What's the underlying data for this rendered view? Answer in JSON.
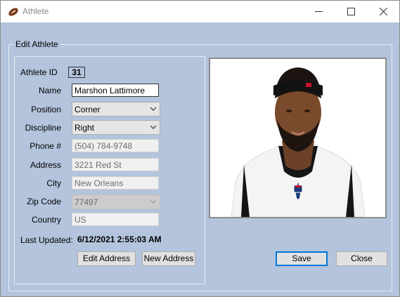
{
  "window": {
    "title": "Athlete",
    "icon": "football-icon"
  },
  "form": {
    "group_title": "Edit Athlete",
    "athlete_id_label": "Athlete ID",
    "athlete_id": "31",
    "name_label": "Name",
    "name_value": "Marshon Lattimore",
    "position_label": "Position",
    "position_value": "Corner",
    "discipline_label": "Discipline",
    "discipline_value": "Right",
    "phone_label": "Phone #",
    "phone_value": "(504) 784-9748",
    "address_label": "Address",
    "address_value": "3221 Red St",
    "city_label": "City",
    "city_value": "New Orleans",
    "zip_label": "Zip Code",
    "zip_value": "77497",
    "country_label": "Country",
    "country_value": "US",
    "last_updated_label": "Last Updated:",
    "last_updated_value": "6/12/2021 2:55:03 AM"
  },
  "buttons": {
    "edit_address": "Edit Address",
    "new_address": "New Address",
    "save": "Save",
    "close": "Close"
  },
  "colors": {
    "form_background": "#b3c4dc",
    "default_button_border": "#0078d7"
  }
}
